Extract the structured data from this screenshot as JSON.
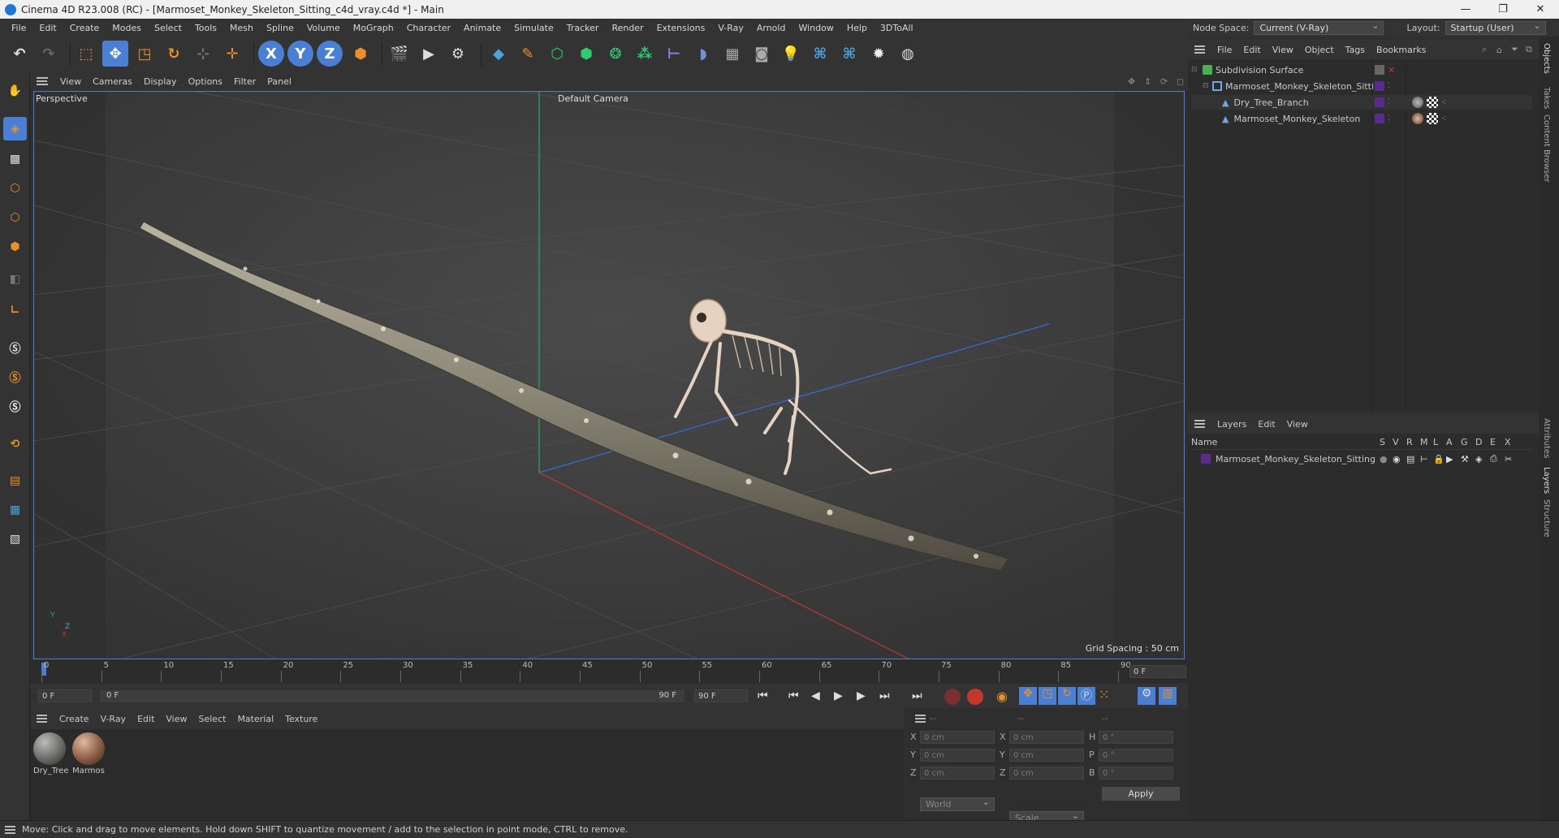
{
  "window": {
    "title": "Cinema 4D R23.008 (RC) - [Marmoset_Monkey_Skeleton_Sitting_c4d_vray.c4d *] - Main",
    "minimize": "—",
    "maximize": "❐",
    "close": "✕"
  },
  "menu": [
    "File",
    "Edit",
    "Create",
    "Modes",
    "Select",
    "Tools",
    "Mesh",
    "Spline",
    "Volume",
    "MoGraph",
    "Character",
    "Animate",
    "Simulate",
    "Tracker",
    "Render",
    "Extensions",
    "V-Ray",
    "Arnold",
    "Window",
    "Help",
    "3DToAll"
  ],
  "nodespace": {
    "label": "Node Space:",
    "value": "Current (V-Ray)"
  },
  "layout": {
    "label": "Layout:",
    "value": "Startup (User)"
  },
  "viewport": {
    "menu": [
      "View",
      "Cameras",
      "Display",
      "Options",
      "Filter",
      "Panel"
    ],
    "name": "Perspective",
    "camera": "Default Camera",
    "grid_spacing": "Grid Spacing : 50 cm",
    "axis_x": "X",
    "axis_y": "Y",
    "axis_z": "Z"
  },
  "timeline": {
    "ticks": [
      "0",
      "5",
      "10",
      "15",
      "20",
      "25",
      "30",
      "35",
      "40",
      "45",
      "50",
      "55",
      "60",
      "65",
      "70",
      "75",
      "80",
      "85",
      "90"
    ],
    "frame_end_field": "0 F",
    "current": "0 F",
    "start_slider": "0 F",
    "end_slider": "90 F",
    "end": "90 F"
  },
  "material_manager": {
    "menu": [
      "Create",
      "V-Ray",
      "Edit",
      "View",
      "Select",
      "Material",
      "Texture"
    ],
    "materials": [
      {
        "name": "Dry_Tree",
        "color": "#6a6a66"
      },
      {
        "name": "Marmos",
        "color": "#8a5d45"
      }
    ]
  },
  "coordinates": {
    "header": [
      "--",
      "--",
      "--"
    ],
    "rows": [
      {
        "l1": "X",
        "v1": "0 cm",
        "l2": "X",
        "v2": "0 cm",
        "l3": "H",
        "v3": "0 °"
      },
      {
        "l1": "Y",
        "v1": "0 cm",
        "l2": "Y",
        "v2": "0 cm",
        "l3": "P",
        "v3": "0 °"
      },
      {
        "l1": "Z",
        "v1": "0 cm",
        "l2": "Z",
        "v2": "0 cm",
        "l3": "B",
        "v3": "0 °"
      }
    ],
    "space": "World",
    "mode": "Scale",
    "apply": "Apply"
  },
  "object_manager": {
    "menu": [
      "File",
      "Edit",
      "View",
      "Object",
      "Tags",
      "Bookmarks"
    ],
    "objects": [
      {
        "name": "Subdivision Surface",
        "depth": 0,
        "color": "#4caf50"
      },
      {
        "name": "Marmoset_Monkey_Skeleton_Sitting",
        "depth": 1,
        "color": "#6fa8dc"
      },
      {
        "name": "Dry_Tree_Branch",
        "depth": 2,
        "color": "#6fa8dc"
      },
      {
        "name": "Marmoset_Monkey_Skeleton",
        "depth": 2,
        "color": "#6fa8dc"
      }
    ]
  },
  "layer_manager": {
    "menu": [
      "Layers",
      "Edit",
      "View"
    ],
    "columns": {
      "name": "Name",
      "flags": [
        "S",
        "V",
        "R",
        "M",
        "L",
        "A",
        "G",
        "D",
        "E",
        "X"
      ]
    },
    "layers": [
      {
        "name": "Marmoset_Monkey_Skeleton_Sitting",
        "color": "#5b2a8a"
      }
    ]
  },
  "side_tabs": [
    "Objects",
    "Takes",
    "Content Browser",
    "Attributes",
    "Layers",
    "Structure"
  ],
  "status": "Move: Click and drag to move elements. Hold down SHIFT to quantize movement / add to the selection in point mode, CTRL to remove.",
  "colors": {
    "accent": "#4a7fd4",
    "ui_bg": "#333333",
    "viewport_bg": "#3c3c3c",
    "x_axis": "#c0392b",
    "y_axis": "#27ae60",
    "z_axis": "#2e6fd8"
  }
}
